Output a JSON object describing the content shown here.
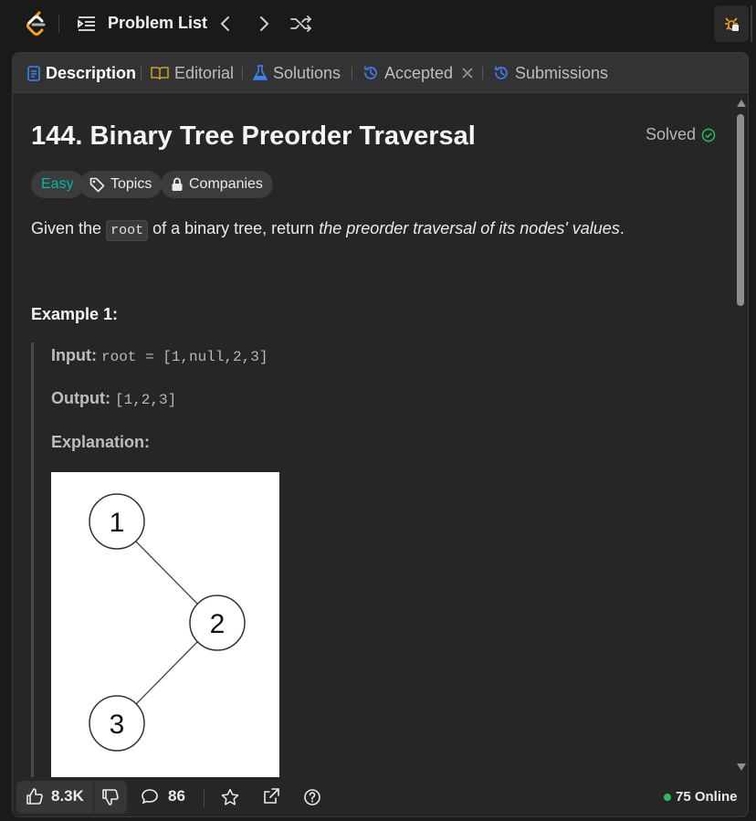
{
  "topbar": {
    "problem_list_label": "Problem List"
  },
  "tabs": [
    {
      "label": "Description",
      "active": true
    },
    {
      "label": "Editorial"
    },
    {
      "label": "Solutions"
    },
    {
      "label": "Accepted"
    },
    {
      "label": "Submissions"
    }
  ],
  "problem": {
    "title": "144. Binary Tree Preorder Traversal",
    "status": "Solved",
    "difficulty": "Easy",
    "topics_label": "Topics",
    "companies_label": "Companies",
    "desc_prefix": "Given the",
    "desc_code": "root",
    "desc_mid": "of a binary tree, return",
    "desc_em": "the preorder traversal of its nodes' values",
    "desc_suffix": "."
  },
  "example1": {
    "heading": "Example 1:",
    "input_label": "Input:",
    "input_value": "root = [1,null,2,3]",
    "output_label": "Output:",
    "output_value": "[1,2,3]",
    "explanation_label": "Explanation:",
    "tree_nodes": [
      "1",
      "2",
      "3"
    ]
  },
  "bottombar": {
    "likes": "8.3K",
    "comments": "86",
    "online": "75 Online"
  },
  "colors": {
    "easy": "#00b8a3",
    "solved_check": "#2cbb5d",
    "active_tab_icon": "#3b82f6",
    "editorial_icon": "#c9a227",
    "solutions_icon": "#3b82f6",
    "online_dot": "#2cbb5d"
  }
}
